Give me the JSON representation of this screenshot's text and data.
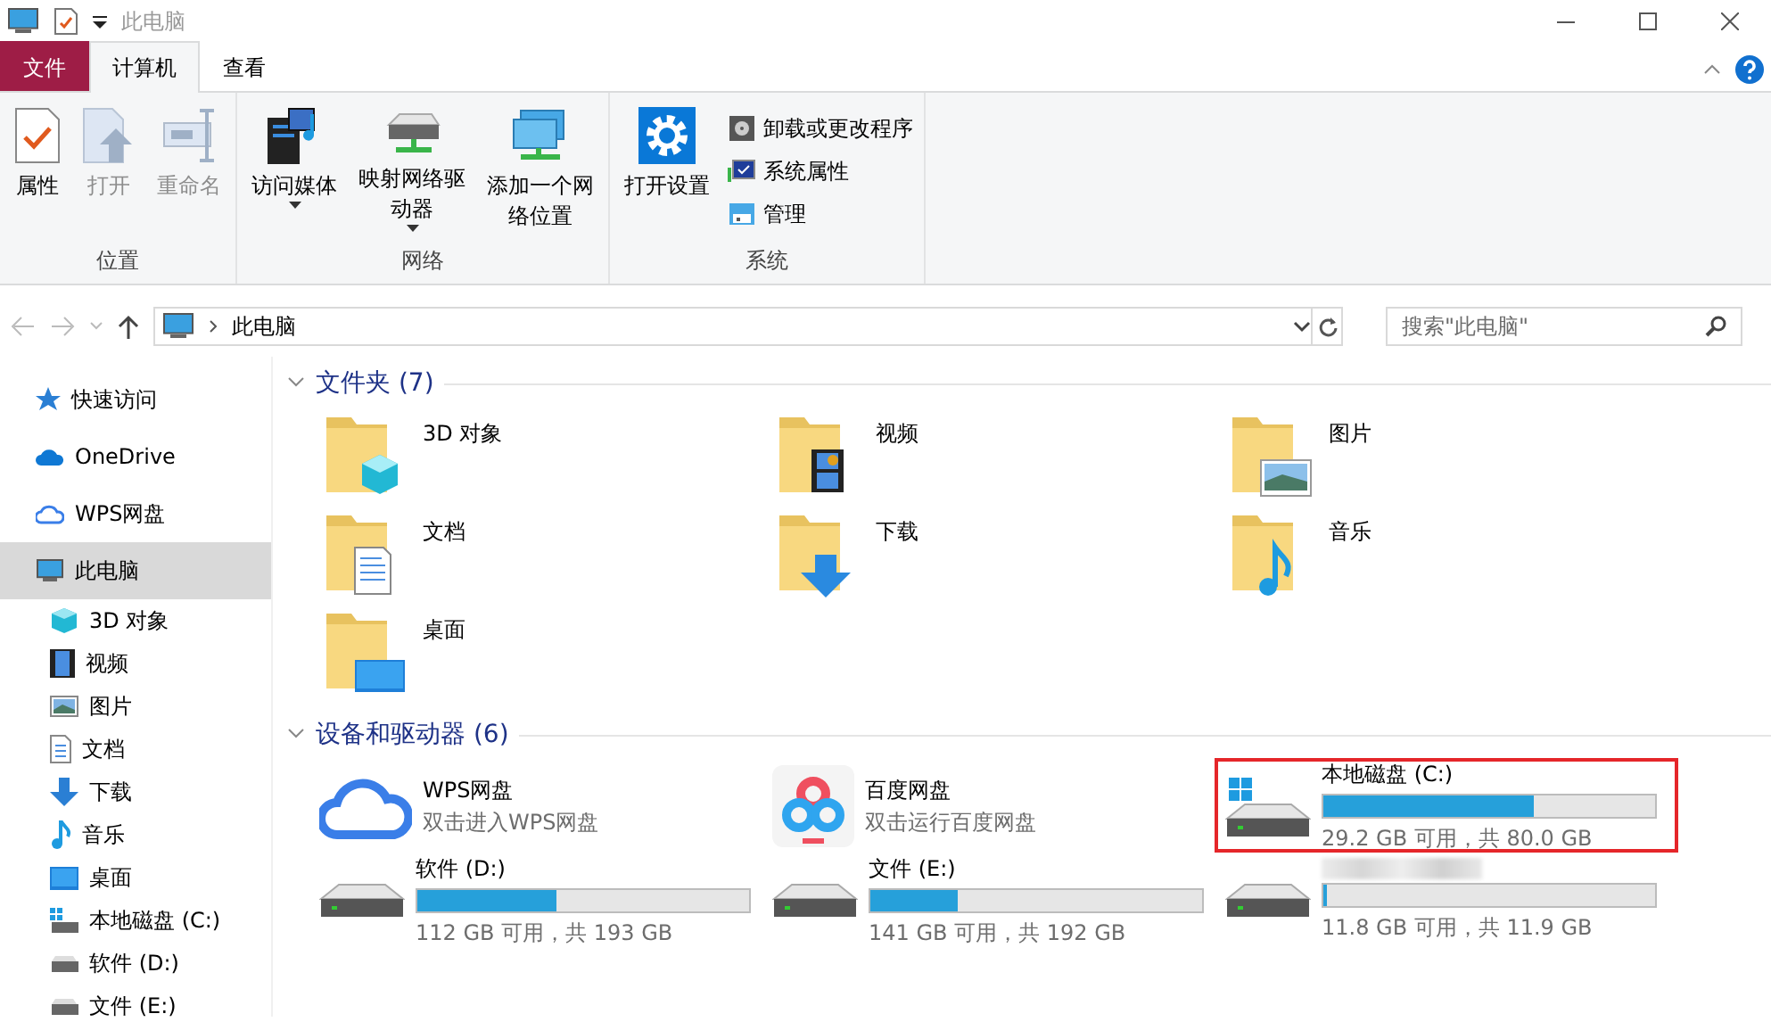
{
  "window": {
    "title": "此电脑"
  },
  "ribbon_tabs": [
    {
      "label": "文件",
      "kind": "file",
      "selected": false
    },
    {
      "label": "计算机",
      "kind": "tab",
      "selected": true
    },
    {
      "label": "查看",
      "kind": "tab",
      "selected": false
    }
  ],
  "ribbon_groups": [
    {
      "label": "位置",
      "buttons": [
        {
          "label": "属性",
          "kind": "large",
          "disabled": false,
          "dropdown": false
        },
        {
          "label": "打开",
          "kind": "large",
          "disabled": true,
          "dropdown": false
        },
        {
          "label": "重命名",
          "kind": "large",
          "disabled": true,
          "dropdown": false
        }
      ]
    },
    {
      "label": "网络",
      "buttons": [
        {
          "label": "访问媒体",
          "kind": "large",
          "disabled": false,
          "dropdown": true
        },
        {
          "label": "映射网络驱动器",
          "kind": "large",
          "disabled": false,
          "dropdown": true
        },
        {
          "label": "添加一个网络位置",
          "kind": "large",
          "disabled": false,
          "dropdown": false
        }
      ]
    },
    {
      "label": "系统",
      "buttons": [
        {
          "label": "打开设置",
          "kind": "large",
          "disabled": false,
          "dropdown": false
        },
        {
          "label": "卸载或更改程序",
          "kind": "small",
          "disabled": false,
          "dropdown": false
        },
        {
          "label": "系统属性",
          "kind": "small",
          "disabled": false,
          "dropdown": false
        },
        {
          "label": "管理",
          "kind": "small",
          "disabled": false,
          "dropdown": false
        }
      ]
    }
  ],
  "address": {
    "path": "此电脑"
  },
  "search": {
    "placeholder": "搜索\"此电脑\""
  },
  "sidebar": {
    "items": [
      {
        "label": "快速访问",
        "selected": false
      },
      {
        "label": "OneDrive",
        "selected": false
      },
      {
        "label": "WPS网盘",
        "selected": false
      },
      {
        "label": "此电脑",
        "selected": true,
        "children": [
          {
            "label": "3D 对象",
            "selected": false
          },
          {
            "label": "视频",
            "selected": false
          },
          {
            "label": "图片",
            "selected": false
          },
          {
            "label": "文档",
            "selected": false
          },
          {
            "label": "下载",
            "selected": false
          },
          {
            "label": "音乐",
            "selected": false
          },
          {
            "label": "桌面",
            "selected": false
          },
          {
            "label": "本地磁盘 (C:)",
            "selected": false
          },
          {
            "label": "软件 (D:)",
            "selected": false
          },
          {
            "label": "文件 (E:)",
            "selected": false
          }
        ]
      }
    ]
  },
  "sections": [
    {
      "title": "文件夹 (7)",
      "expanded": true,
      "items": [
        {
          "kind": "folder",
          "name": "3D 对象"
        },
        {
          "kind": "folder",
          "name": "视频"
        },
        {
          "kind": "folder",
          "name": "图片"
        },
        {
          "kind": "folder",
          "name": "文档"
        },
        {
          "kind": "folder",
          "name": "下载"
        },
        {
          "kind": "folder",
          "name": "音乐"
        },
        {
          "kind": "folder",
          "name": "桌面"
        }
      ]
    },
    {
      "title": "设备和驱动器 (6)",
      "expanded": true,
      "items": [
        {
          "kind": "app",
          "name": "WPS网盘",
          "subtitle": "双击进入WPS网盘"
        },
        {
          "kind": "app",
          "name": "百度网盘",
          "subtitle": "双击运行百度网盘"
        },
        {
          "kind": "drive",
          "name": "本地磁盘 (C:)",
          "level": 0.635,
          "reading": "29.2 GB 可用，共 80.0 GB",
          "highlighted": true,
          "system": true
        },
        {
          "kind": "drive",
          "name": "软件 (D:)",
          "level": 0.42,
          "reading": "112 GB 可用，共 193 GB",
          "highlighted": false,
          "system": false
        },
        {
          "kind": "drive",
          "name": "文件 (E:)",
          "level": 0.266,
          "reading": "141 GB 可用，共 192 GB",
          "highlighted": false,
          "system": false
        },
        {
          "kind": "drive",
          "level": 0.01,
          "reading": "11.8 GB 可用，共 11.9 GB",
          "highlighted": false,
          "system": false
        }
      ]
    }
  ]
}
